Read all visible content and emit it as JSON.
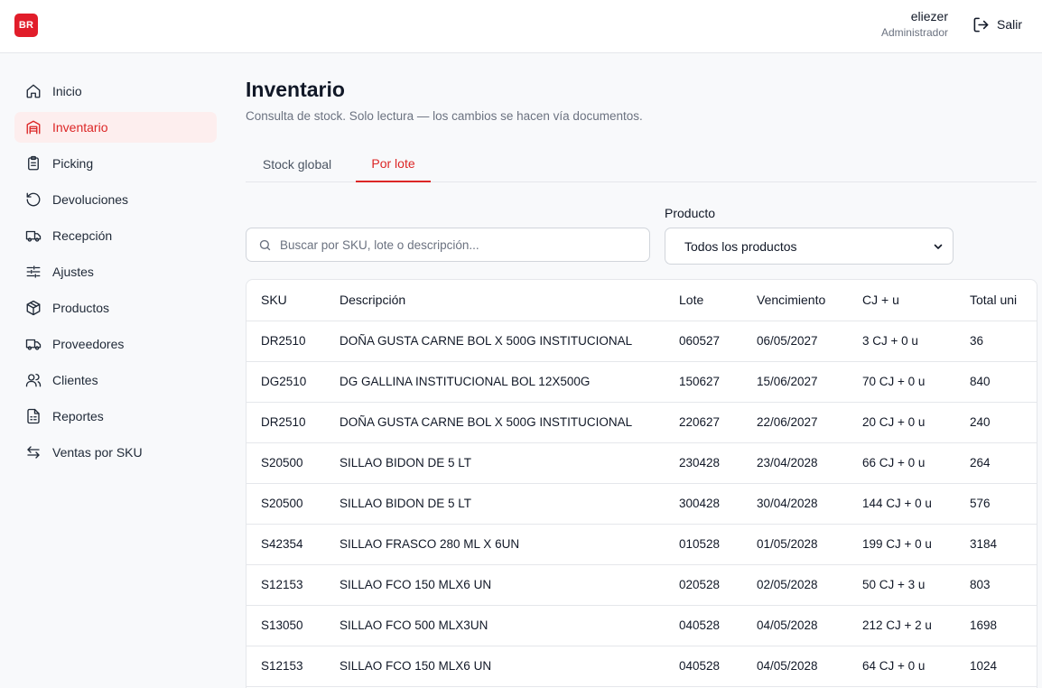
{
  "header": {
    "logo_text": "BR",
    "user_name": "eliezer",
    "user_role": "Administrador",
    "logout_label": "Salir"
  },
  "sidebar": {
    "items": [
      {
        "label": "Inicio",
        "icon": "home-icon"
      },
      {
        "label": "Inventario",
        "icon": "warehouse-icon",
        "active": true
      },
      {
        "label": "Picking",
        "icon": "clipboard-icon"
      },
      {
        "label": "Devoluciones",
        "icon": "rotate-ccw-icon"
      },
      {
        "label": "Recepción",
        "icon": "truck-icon"
      },
      {
        "label": "Ajustes",
        "icon": "sliders-icon"
      },
      {
        "label": "Productos",
        "icon": "package-icon"
      },
      {
        "label": "Proveedores",
        "icon": "truck-icon"
      },
      {
        "label": "Clientes",
        "icon": "users-icon"
      },
      {
        "label": "Reportes",
        "icon": "file-report-icon"
      },
      {
        "label": "Ventas por SKU",
        "icon": "arrows-swap-icon"
      }
    ]
  },
  "page": {
    "title": "Inventario",
    "subtitle": "Consulta de stock. Solo lectura — los cambios se hacen vía documentos."
  },
  "tabs": [
    {
      "label": "Stock global",
      "active": false
    },
    {
      "label": "Por lote",
      "active": true
    }
  ],
  "filters": {
    "search_placeholder": "Buscar por SKU, lote o descripción...",
    "product_label": "Producto",
    "product_selected": "Todos los productos"
  },
  "table": {
    "columns": [
      "SKU",
      "Descripción",
      "Lote",
      "Vencimiento",
      "CJ + u",
      "Total uni"
    ],
    "rows": [
      [
        "DR2510",
        "DOÑA GUSTA CARNE BOL X 500G INSTITUCIONAL",
        "060527",
        "06/05/2027",
        "3 CJ + 0 u",
        "36"
      ],
      [
        "DG2510",
        "DG GALLINA INSTITUCIONAL BOL 12X500G",
        "150627",
        "15/06/2027",
        "70 CJ + 0 u",
        "840"
      ],
      [
        "DR2510",
        "DOÑA GUSTA CARNE BOL X 500G INSTITUCIONAL",
        "220627",
        "22/06/2027",
        "20 CJ + 0 u",
        "240"
      ],
      [
        "S20500",
        "SILLAO BIDON DE 5 LT",
        "230428",
        "23/04/2028",
        "66 CJ + 0 u",
        "264"
      ],
      [
        "S20500",
        "SILLAO BIDON DE 5 LT",
        "300428",
        "30/04/2028",
        "144 CJ + 0 u",
        "576"
      ],
      [
        "S42354",
        "SILLAO FRASCO 280 ML X 6UN",
        "010528",
        "01/05/2028",
        "199 CJ + 0 u",
        "3184"
      ],
      [
        "S12153",
        "SILLAO FCO 150 MLX6 UN",
        "020528",
        "02/05/2028",
        "50 CJ + 3 u",
        "803"
      ],
      [
        "S13050",
        "SILLAO FCO 500 MLX3UN",
        "040528",
        "04/05/2028",
        "212 CJ + 2 u",
        "1698"
      ],
      [
        "S12153",
        "SILLAO FCO 150 MLX6 UN",
        "040528",
        "04/05/2028",
        "64 CJ + 0 u",
        "1024"
      ]
    ]
  },
  "colors": {
    "accent": "#dc2626",
    "logo_bg": "#e11d2a",
    "active_nav_bg": "#fdeeee"
  }
}
